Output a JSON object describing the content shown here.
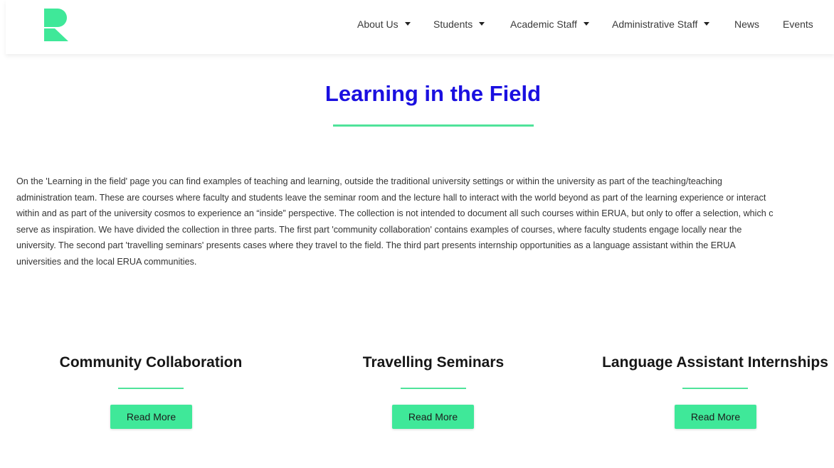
{
  "header": {
    "logo_alt": "R",
    "nav": [
      {
        "label": "About Us",
        "has_dropdown": true
      },
      {
        "label": "Students",
        "has_dropdown": true
      },
      {
        "label": "Academic Staff",
        "has_dropdown": true
      },
      {
        "label": "Administrative Staff",
        "has_dropdown": true
      },
      {
        "label": "News",
        "has_dropdown": false
      },
      {
        "label": "Events",
        "has_dropdown": false
      }
    ]
  },
  "main": {
    "title": "Learning in the Field",
    "intro_lines": [
      "On the 'Learning in the field' page you can find examples of teaching and learning, outside the traditional university settings or within the university as part of the teaching/teaching",
      "administration team. These are courses where faculty and students leave the seminar room and the lecture hall to interact with the world beyond as part of the learning experience or interact",
      "within and as part of the university cosmos to experience an “inside” perspective. The collection is not intended to document all such courses within ERUA, but only to offer a selection, which c",
      "serve as inspiration. We have divided the collection in three parts. The first part 'community collaboration' contains examples of courses, where faculty students engage locally near the",
      "university. The second part 'travelling seminars' presents cases where they travel to the field. The third part presents internship opportunities as a language assistant within the ERUA",
      "universities and the local ERUA communities."
    ],
    "cards": [
      {
        "title": "Community Collaboration",
        "button": "Read More"
      },
      {
        "title": "Travelling Seminars",
        "button": "Read More"
      },
      {
        "title": "Language Assistant Internships",
        "button": "Read More"
      }
    ]
  },
  "colors": {
    "accent": "#4fe39a",
    "button": "#3fe899",
    "title": "#1a0fe0",
    "logo": "#3fe899"
  }
}
